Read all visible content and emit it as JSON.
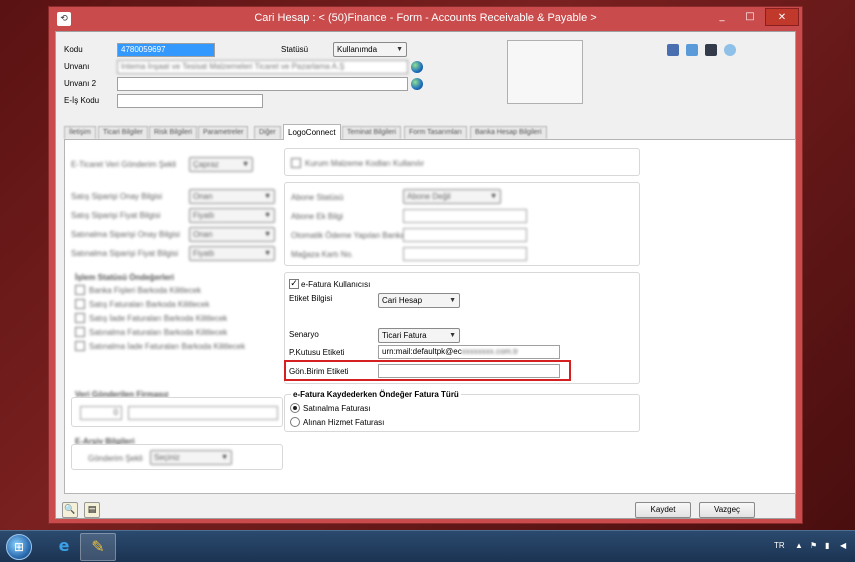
{
  "window": {
    "title": "Cari Hesap : < (50)Finance - Form - Accounts Receivable & Payable >",
    "app_icon": "app-icon",
    "min_label": "_",
    "max_label": "□",
    "close_label": "✕"
  },
  "header": {
    "kodu_label": "Kodu",
    "kodu_value": "4780059697",
    "unvani_label": "Unvanı",
    "unvani_value": "Intema İnşaat ve Tesisat Malzemeleri Ticaret ve Pazarlama A.Ş",
    "unvani2_label": "Unvanı 2",
    "unvani2_value": "",
    "eis_label": "E-İş Kodu",
    "eis_value": "",
    "status_label": "Statüsü",
    "status_value": "Kullanımda"
  },
  "tabs": [
    {
      "label": "İletişim"
    },
    {
      "label": "Ticari Bilgiler"
    },
    {
      "label": "Risk Bilgileri"
    },
    {
      "label": "Parametreler"
    },
    {
      "label": "Diğer"
    },
    {
      "label": "LogoConnect"
    },
    {
      "label": "Teminat Bilgileri"
    },
    {
      "label": "Form Tasarımları"
    },
    {
      "label": "Banka Hesap Bilgileri"
    }
  ],
  "left": {
    "eticaret_label": "E-Ticaret Veri Gönderim Şekli",
    "eticaret_value": "Çapraz",
    "order_rows": [
      {
        "label": "Satış Siparişi Onay Bilgisi",
        "value": "Onan"
      },
      {
        "label": "Satış Siparişi Fiyat Bilgisi",
        "value": "Fiyatlı"
      },
      {
        "label": "Satınalma Siparişi Onay Bilgisi",
        "value": "Onan"
      },
      {
        "label": "Satınalma Siparişi Fiyat Bilgisi",
        "value": "Fiyatlı"
      }
    ],
    "process_title": "İşlem Statüsü Öndeğerleri",
    "process_items": [
      {
        "label": "Banka Fişleri Barkoda Kilitlecek"
      },
      {
        "label": "Satış Faturaları Barkoda Kilitlecek"
      },
      {
        "label": "Satış İade Faturaları Barkoda Kilitlecek"
      },
      {
        "label": "Satınalma Faturaları Barkoda Kilitlecek"
      },
      {
        "label": "Satınalma İade Faturaları Barkoda Kilitlecek"
      }
    ],
    "sender_title": "Veri Gönderilen Firmasız",
    "sender_value": "0",
    "earsiv_title": "E-Arşiv Bilgileri",
    "gonderim_label": "Gönderim Şekli",
    "gonderim_value": "Seçiniz"
  },
  "right": {
    "alias_checkbox_label": "Kurum Malzeme Kodları Kullanılır",
    "abone_statusu_label": "Abone Statüsü",
    "abone_statusu_value": "Abone Değil",
    "abone_bilgi_label": "Abone Ek Bilgi",
    "otomatik_label": "Otomatik Ödeme Yapılan Banka",
    "mahsup_label": "Mağaza Kartı No.",
    "efatura_checkbox_label": "e-Fatura Kullanıcısı",
    "efatura_checked": "✓",
    "etiket_label": "Etiket Bilgisi",
    "etiket_value": "Cari Hesap",
    "senaryo_label": "Senaryo",
    "senaryo_value": "Ticari Fatura",
    "pkutusu_label": "P.Kutusu Etiketi",
    "pkutusu_value": "urn:mail:defaultpk@ec",
    "pkutusu_blur": "xxxxxxxx.com.tr",
    "gonbirim_label": "Gön.Birim Etiketi",
    "gonbirim_value": "",
    "default_type_title": "e-Fatura Kaydederken Öndeğer Fatura Türü",
    "radio_options": [
      {
        "label": "Satınalma Faturası",
        "checked": true
      },
      {
        "label": "Alınan Hizmet Faturası",
        "checked": false
      }
    ]
  },
  "footer": {
    "save_label": "Kaydet",
    "cancel_label": "Vazgeç"
  },
  "taskbar": {
    "lang": "TR",
    "ie_icon": "e",
    "tool_icon": "✎"
  }
}
